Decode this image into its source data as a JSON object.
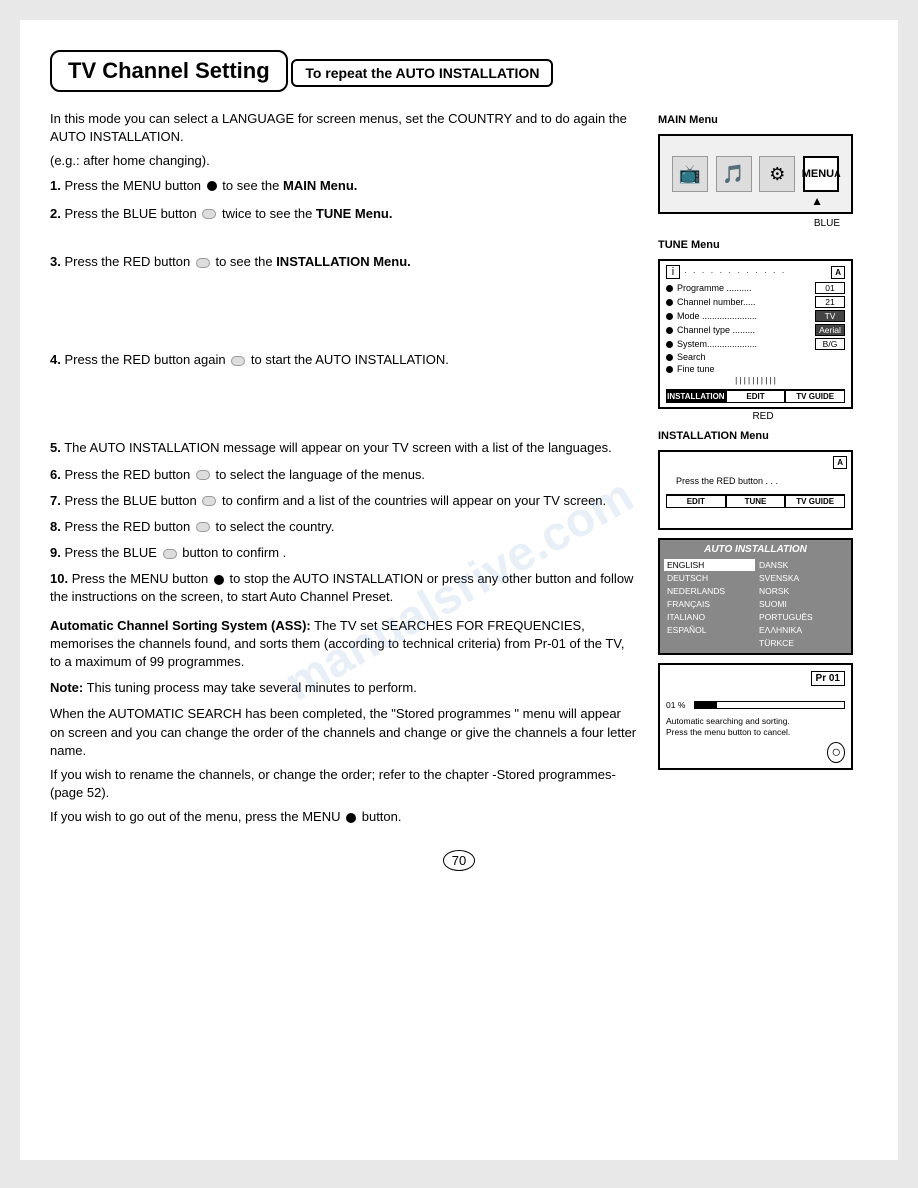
{
  "page": {
    "title": "TV Channel Setting",
    "section_title": "To repeat the AUTO INSTALLATION",
    "page_number": "70",
    "watermark": "manualsrive.com"
  },
  "intro": {
    "line1": "In this mode you can select a LANGUAGE for screen menus, set the COUNTRY and to do again the AUTO INSTALLATION.",
    "line2": "(e.g.: after home changing)."
  },
  "steps": [
    {
      "num": "1.",
      "text": "Press the MENU button",
      "text2": "to see the",
      "bold": "MAIN Menu."
    },
    {
      "num": "2.",
      "text": "Press the BLUE  button",
      "text2": "twice to see the",
      "bold": "TUNE Menu."
    },
    {
      "num": "3.",
      "text": "Press the RED button",
      "text2": "to see the",
      "bold": "INSTALLATION Menu."
    },
    {
      "num": "4.",
      "text": "Press the RED button again",
      "text2": "to start the AUTO INSTALLATION."
    }
  ],
  "steps_cont": [
    {
      "num": "5.",
      "text": "The AUTO INSTALLATION message will appear on your TV screen with a list of the languages."
    },
    {
      "num": "6.",
      "text": "Press the RED button",
      "text2": "to select the language of the menus."
    },
    {
      "num": "7.",
      "text": "Press the BLUE button",
      "text2": "to confirm and a list of the countries will appear on your TV screen."
    },
    {
      "num": "8.",
      "text": "Press the RED button",
      "text2": "to select the country."
    },
    {
      "num": "9.",
      "text": "Press the BLUE",
      "text2": "button to confirm ."
    },
    {
      "num": "10.",
      "text": "Press the MENU button",
      "text2": "to stop the AUTO INSTALLATION or press any other button and follow the instructions on the screen, to start Auto Channel Preset."
    }
  ],
  "ass_title": "Automatic Channel Sorting System (ASS):",
  "ass_text": "The TV set SEARCHES FOR FREQUENCIES, memorises the channels found, and sorts them (according to technical criteria) from Pr-01 of the TV, to a maximum of 99 programmes.",
  "note_title": "Note:",
  "note_text": "This tuning process may take several minutes to perform.",
  "final_text1": "When the AUTOMATIC SEARCH has been completed, the \"Stored programmes \" menu will appear on screen and you can change the order of the channels and change or give the channels a four letter name.",
  "final_text2": "If you wish to rename the channels, or change the order; refer to the chapter -Stored programmes- (page 52).",
  "final_text3": "If you wish to go out of the menu, press the MENU",
  "final_text3b": "button.",
  "main_menu_label": "MAIN Menu",
  "blue_label": "BLUE",
  "tune_menu_label": "TUNE Menu",
  "red_label": "RED",
  "installation_menu_label": "INSTALLATION Menu",
  "tune_rows": [
    {
      "label": "Programme ..........",
      "value": "01"
    },
    {
      "label": "Channel number.....",
      "value": "21"
    },
    {
      "label": "Mode ......................",
      "value": "TV",
      "highlight": true
    },
    {
      "label": "Channel type .........",
      "value": "Aerial",
      "highlight": true
    },
    {
      "label": "System....................",
      "value": "B/G",
      "highlight": false
    },
    {
      "label": "Search"
    },
    {
      "label": "Fine tune"
    }
  ],
  "tune_tabs": [
    "INSTALLATION",
    "EDIT",
    "TV GUIDE"
  ],
  "install_tabs": [
    "EDIT",
    "TUNE",
    "TV GUIDE"
  ],
  "install_content": "Press the RED button . . .",
  "lang_list": [
    "ENGLISH",
    "DANSK",
    "DEUTSCH",
    "SVENSKA",
    "NEDERLANDS",
    "NORSK",
    "FRANÇAIS",
    "SUOMI",
    "ITALIANO",
    "PORTUGUÊS",
    "ESPAÑOL",
    "ΕΛΛΗΝΙΚΑ",
    "",
    "TÜRKCE"
  ],
  "pr_title": "Pr 01",
  "pr_pct": "01 %",
  "pr_text1": "Automatic searching and sorting.",
  "pr_text2": "Press the menu button to cancel."
}
